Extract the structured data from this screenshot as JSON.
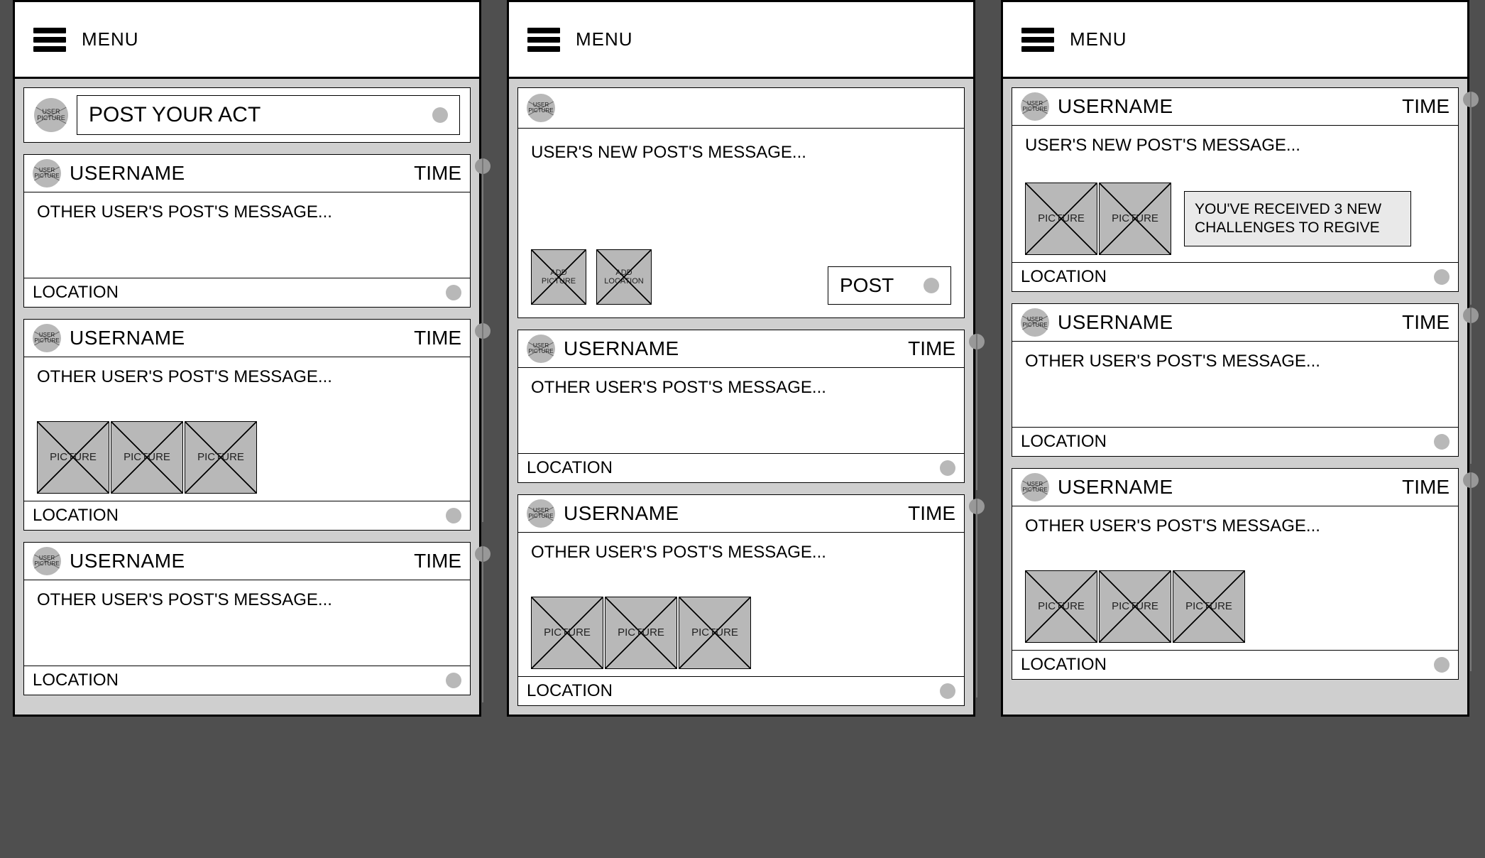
{
  "menu_label": "MENU",
  "avatar_text": "USER\nPICTURE",
  "picture_text": "PICTURE",
  "frame1": {
    "compose_placeholder": "POST YOUR ACT",
    "posts": [
      {
        "username": "USERNAME",
        "time": "TIME",
        "message": "OTHER USER'S POST'S MESSAGE...",
        "location": "LOCATION",
        "pictures": 0
      },
      {
        "username": "USERNAME",
        "time": "TIME",
        "message": "OTHER USER'S POST'S MESSAGE...",
        "location": "LOCATION",
        "pictures": 3
      },
      {
        "username": "USERNAME",
        "time": "TIME",
        "message": "OTHER USER'S POST'S MESSAGE...",
        "location": "LOCATION",
        "pictures": 0
      }
    ]
  },
  "frame2": {
    "compose": {
      "message": "USER'S NEW POST'S MESSAGE...",
      "add_picture_label": "ADD\nPICTURE",
      "add_location_label": "ADD\nLOCATION",
      "post_button": "POST"
    },
    "posts": [
      {
        "username": "USERNAME",
        "time": "TIME",
        "message": "OTHER USER'S POST'S MESSAGE...",
        "location": "LOCATION",
        "pictures": 0
      },
      {
        "username": "USERNAME",
        "time": "TIME",
        "message": "OTHER USER'S POST'S MESSAGE...",
        "location": "LOCATION",
        "pictures": 3
      }
    ]
  },
  "frame3": {
    "notification": "YOU'VE RECEIVED 3 NEW CHALLENGES TO REGIVE",
    "posts": [
      {
        "username": "USERNAME",
        "time": "TIME",
        "message": "USER'S NEW POST'S MESSAGE...",
        "location": "LOCATION",
        "pictures": 2,
        "has_notification": true
      },
      {
        "username": "USERNAME",
        "time": "TIME",
        "message": "OTHER USER'S POST'S MESSAGE...",
        "location": "LOCATION",
        "pictures": 0
      },
      {
        "username": "USERNAME",
        "time": "TIME",
        "message": "OTHER USER'S POST'S MESSAGE...",
        "location": "LOCATION",
        "pictures": 3
      }
    ]
  }
}
